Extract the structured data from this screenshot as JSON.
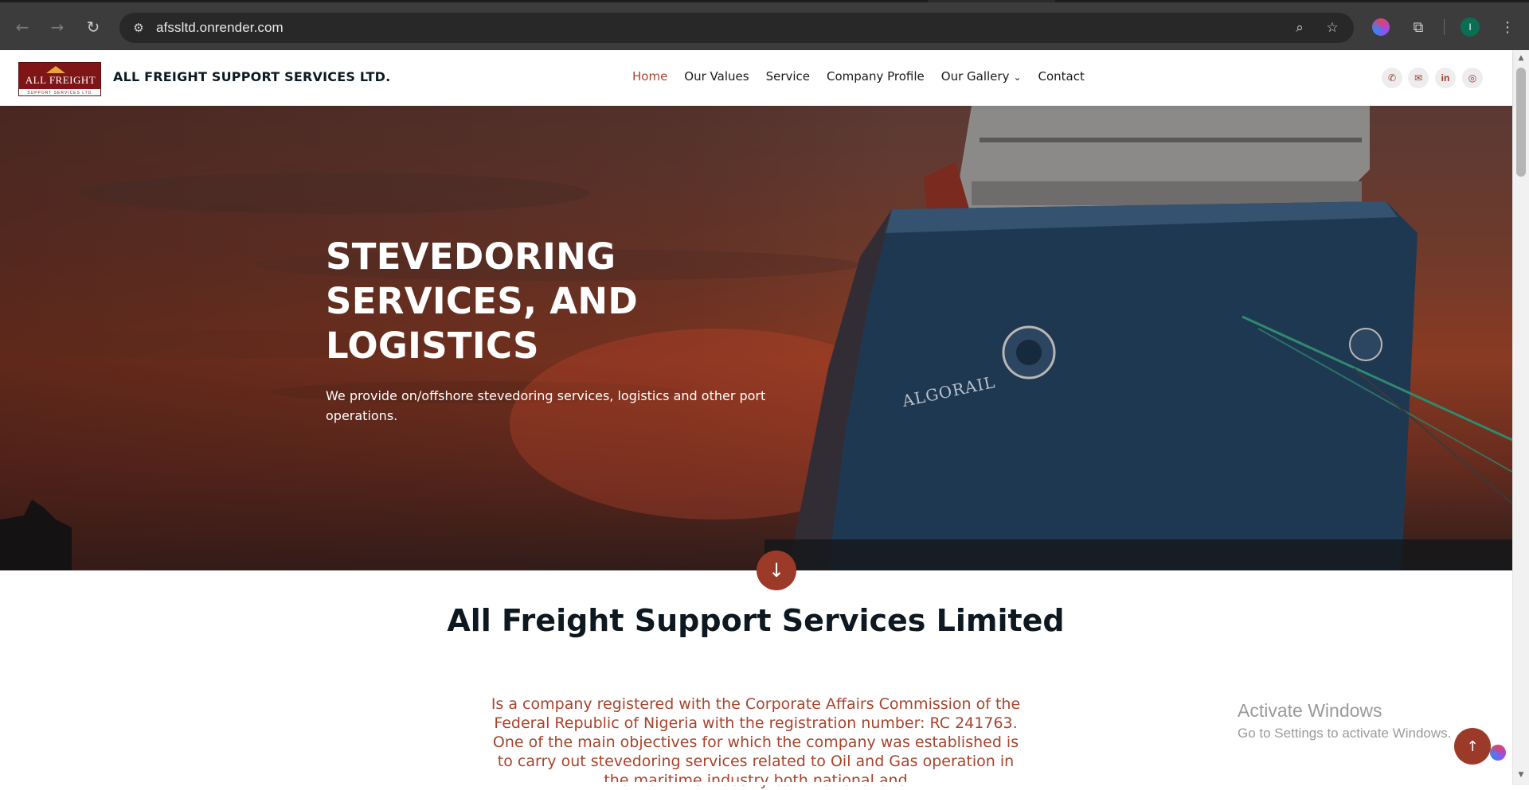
{
  "browser": {
    "url": "afssltd.onrender.com",
    "profile_initial": "I"
  },
  "site": {
    "logo": {
      "main": "ALL FREIGHT",
      "sub": "SUPPORT SERVICES LTD."
    },
    "brand_name": "ALL FREIGHT SUPPORT SERVICES LTD.",
    "nav": [
      {
        "label": "Home",
        "active": true
      },
      {
        "label": "Our Values",
        "active": false
      },
      {
        "label": "Service",
        "active": false
      },
      {
        "label": "Company Profile",
        "active": false
      },
      {
        "label": "Our Gallery",
        "active": false,
        "dropdown": true
      },
      {
        "label": "Contact",
        "active": false
      }
    ],
    "social_icons": [
      "phone-icon",
      "email-icon",
      "linkedin-icon",
      "whatsapp-icon"
    ],
    "accent_color": "#9b3a28"
  },
  "hero": {
    "title": "STEVEDORING SERVICES, AND LOGISTICS",
    "subtitle": "We provide on/offshore stevedoring services, logistics and other port operations.",
    "ship_name": "ALGORAIL"
  },
  "about": {
    "title": "All Freight Support Services Limited",
    "text": "Is a company registered with the Corporate Affairs Commission of the Federal Republic of Nigeria with the registration number: RC 241763. One of the main objectives for which the company was established is to carry out stevedoring services related to Oil and Gas operation in the maritime industry both national and"
  },
  "windows_watermark": {
    "line1": "Activate Windows",
    "line2": "Go to Settings to activate Windows."
  }
}
